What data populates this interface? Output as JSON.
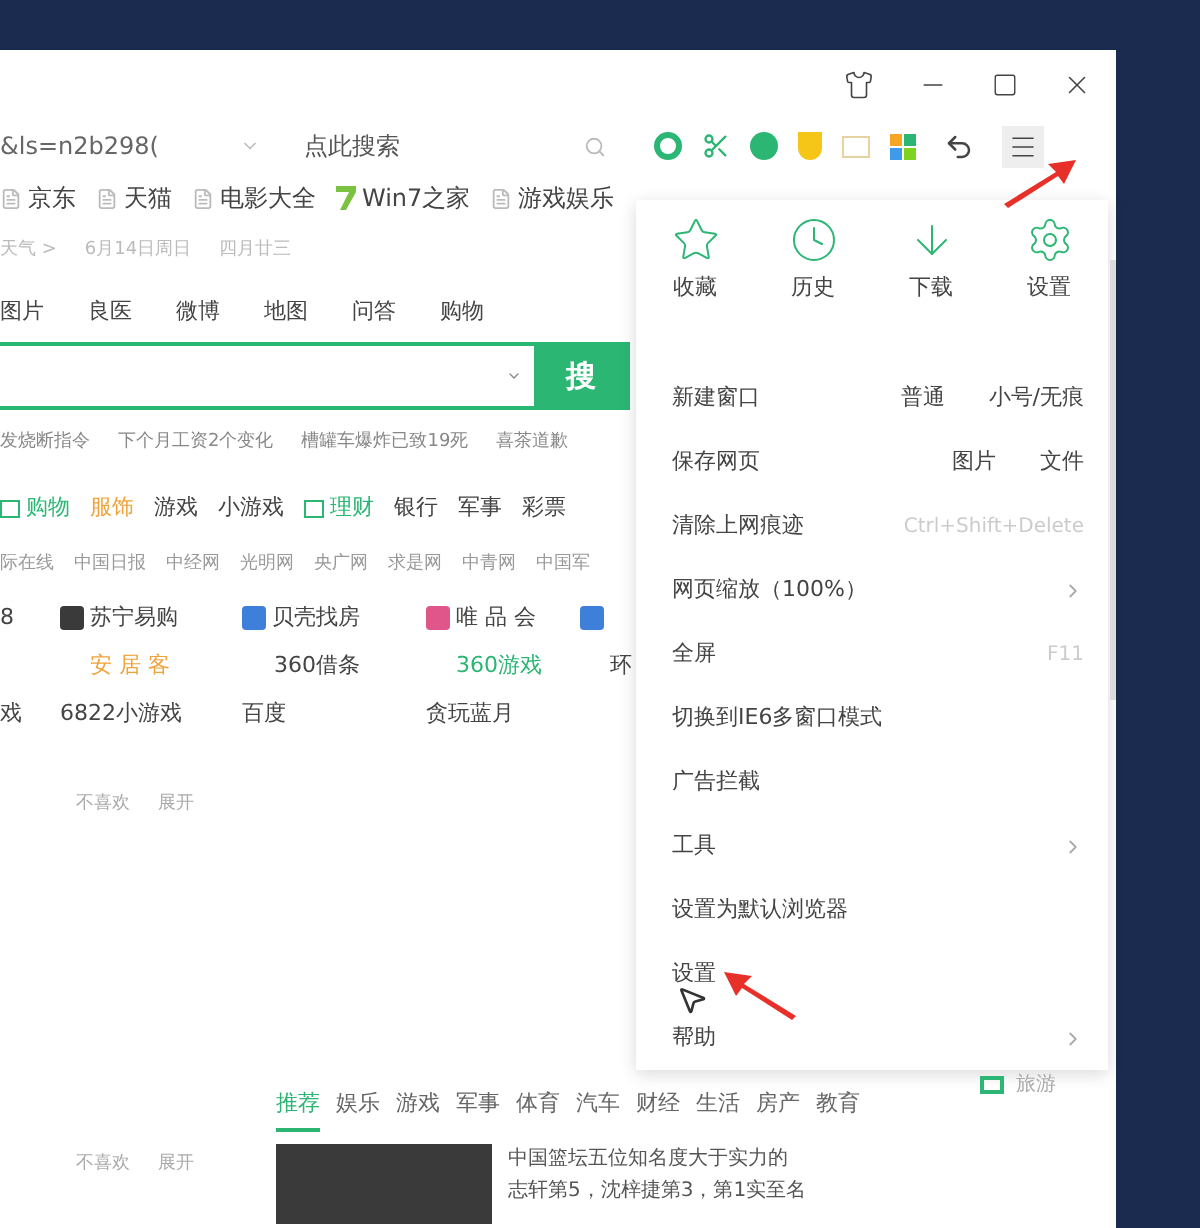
{
  "address_bar": {
    "url": "&ls=n2b298(",
    "search_placeholder": "点此搜索"
  },
  "bookmarks": [
    {
      "label": "京东",
      "kind": "page"
    },
    {
      "label": "天猫",
      "kind": "page"
    },
    {
      "label": "电影大全",
      "kind": "page"
    },
    {
      "label": "Win7之家",
      "kind": "seven"
    },
    {
      "label": "游戏娱乐",
      "kind": "page"
    }
  ],
  "info_line": [
    "天气 >",
    "6月14日周日",
    "四月廿三"
  ],
  "search_tabs": [
    "图片",
    "良医",
    "微博",
    "地图",
    "问答",
    "购物"
  ],
  "search": {
    "button": "搜"
  },
  "hot_searches": [
    "发烧断指令",
    "下个月工资2个变化",
    "槽罐车爆炸已致19死",
    "喜茶道歉"
  ],
  "categories": [
    {
      "label": "购物",
      "kind": "icon",
      "color": "#2bb673"
    },
    {
      "label": "服饰",
      "kind": "plain",
      "color": "#f0a33a"
    },
    {
      "label": "游戏",
      "kind": "plain",
      "color": "#444444"
    },
    {
      "label": "小游戏",
      "kind": "plain",
      "color": "#444444"
    },
    {
      "label": "理财",
      "kind": "icon",
      "color": "#2bb673"
    },
    {
      "label": "银行",
      "kind": "plain",
      "color": "#444444"
    },
    {
      "label": "军事",
      "kind": "plain",
      "color": "#444444"
    },
    {
      "label": "彩票",
      "kind": "plain",
      "color": "#444444"
    }
  ],
  "news_sites": [
    "际在线",
    "中国日报",
    "中经网",
    "光明网",
    "央广网",
    "求是网",
    "中青网",
    "中国军"
  ],
  "site_rows": [
    {
      "kind": "full",
      "items": [
        {
          "label": "8",
          "color": "#444444",
          "kind": "plain"
        },
        {
          "label": "苏宁易购",
          "color": "#444444",
          "kind": "logo"
        },
        {
          "label": "贝壳找房",
          "color": "#444444",
          "kind": "logo"
        },
        {
          "label": "唯 品 会",
          "color": "#444444",
          "kind": "logo"
        }
      ]
    },
    {
      "kind": "shifted",
      "items": [
        {
          "label": "安 居 客",
          "color": "#f0a33a",
          "kind": "plain"
        },
        {
          "label": "360借条",
          "color": "#444444",
          "kind": "plain"
        },
        {
          "label": "360游戏",
          "color": "#2bb673",
          "kind": "plain"
        },
        {
          "label": "环",
          "color": "#444444",
          "kind": "plain"
        }
      ]
    },
    {
      "kind": "full",
      "items": [
        {
          "label": "戏",
          "color": "#444444",
          "kind": "plain"
        },
        {
          "label": "6822小游戏",
          "color": "#444444",
          "kind": "plain"
        },
        {
          "label": "百度",
          "color": "#444444",
          "kind": "plain"
        },
        {
          "label": "贪玩蓝月",
          "color": "#444444",
          "kind": "plain"
        }
      ]
    }
  ],
  "feedback_1": [
    "不喜欢",
    "展开"
  ],
  "feed_tabs": [
    {
      "label": "推荐",
      "selected": true
    },
    {
      "label": "娱乐",
      "selected": false
    },
    {
      "label": "游戏",
      "selected": false
    },
    {
      "label": "军事",
      "selected": false
    },
    {
      "label": "体育",
      "selected": false
    },
    {
      "label": "汽车",
      "selected": false
    },
    {
      "label": "财经",
      "selected": false
    },
    {
      "label": "生活",
      "selected": false
    },
    {
      "label": "房产",
      "selected": false
    },
    {
      "label": "教育",
      "selected": false
    }
  ],
  "feedback_2": [
    "不喜欢",
    "展开"
  ],
  "news_item": {
    "lines": [
      "中国篮坛五位知名度大于实力的",
      "志轩第5，沈梓捷第3，第1实至名"
    ]
  },
  "travel_label": "旅游",
  "menu": {
    "quick": [
      {
        "label": "收藏",
        "kind": "star"
      },
      {
        "label": "历史",
        "kind": "clock"
      },
      {
        "label": "下载",
        "kind": "download"
      },
      {
        "label": "设置",
        "kind": "gear"
      }
    ],
    "items": [
      {
        "label": "新建窗口",
        "kind": "options",
        "options": [
          "普通",
          "小号/无痕"
        ]
      },
      {
        "label": "保存网页",
        "kind": "options",
        "options": [
          "图片",
          "文件"
        ]
      },
      {
        "label": "清除上网痕迹",
        "kind": "shortcut",
        "shortcut": "Ctrl+Shift+Delete"
      },
      {
        "label": "网页缩放（100%）",
        "kind": "submenu"
      },
      {
        "label": "全屏",
        "kind": "shortcut",
        "shortcut": "F11"
      },
      {
        "label": "切换到IE6多窗口模式",
        "kind": "plain"
      },
      {
        "label": "广告拦截",
        "kind": "plain"
      },
      {
        "label": "工具",
        "kind": "submenu"
      },
      {
        "label": "设置为默认浏览器",
        "kind": "plain"
      },
      {
        "label": "设置",
        "kind": "plain"
      },
      {
        "label": "帮助",
        "kind": "submenu"
      }
    ]
  }
}
